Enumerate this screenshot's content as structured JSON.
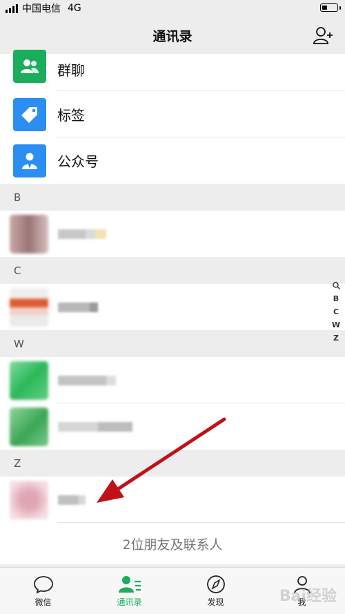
{
  "status_bar": {
    "carrier": "中国电信",
    "network": "4G"
  },
  "nav": {
    "title": "通讯录"
  },
  "top_items": [
    {
      "label": "群聊",
      "color": "#1aad5c",
      "icon": "group-chat-icon"
    },
    {
      "label": "标签",
      "color": "#2b8ef0",
      "icon": "tag-icon"
    },
    {
      "label": "公众号",
      "color": "#2b8ef0",
      "icon": "official-account-icon"
    }
  ],
  "sections": [
    {
      "letter": "B"
    },
    {
      "letter": "C"
    },
    {
      "letter": "W"
    },
    {
      "letter": "Z"
    }
  ],
  "index_letters": [
    "B",
    "C",
    "W",
    "Z"
  ],
  "footer_count": "2位朋友及联系人",
  "tabs": [
    {
      "label": "微信",
      "icon": "chat-bubble-icon"
    },
    {
      "label": "通讯录",
      "icon": "contacts-icon",
      "active": true
    },
    {
      "label": "发现",
      "icon": "compass-icon"
    },
    {
      "label": "我",
      "icon": "me-icon"
    }
  ],
  "watermark": "Bai经验",
  "colors": {
    "accent": "#1aad5c",
    "arrow": "#c0111a"
  }
}
